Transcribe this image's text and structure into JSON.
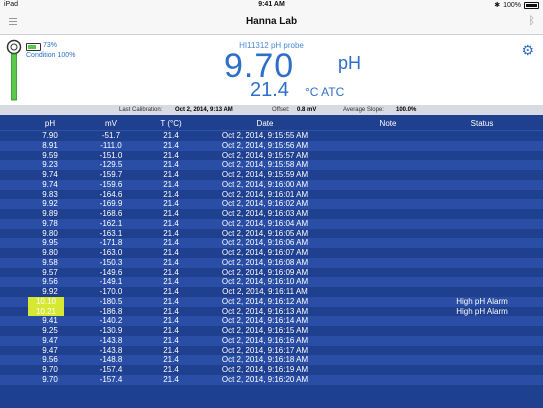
{
  "statusbar": {
    "device": "iPad",
    "time": "9:41 AM",
    "battery": "100%"
  },
  "navbar": {
    "title": "Hanna Lab"
  },
  "probe": {
    "battery_pct": "73%",
    "condition": "Condition 100%",
    "name": "HI11312 pH probe",
    "ph_value": "9.70",
    "ph_unit": "pH",
    "temp_value": "21.4",
    "temp_unit": "°C ATC"
  },
  "calibration": {
    "last_label": "Last Calibration:",
    "last_value": "Oct 2, 2014, 9:13 AM",
    "offset_label": "Offset:",
    "offset_value": "0.8 mV",
    "slope_label": "Average Slope:",
    "slope_value": "100.0%"
  },
  "table": {
    "headers": {
      "ph": "pH",
      "mv": "mV",
      "t": "T (°C)",
      "date": "Date",
      "note": "Note",
      "status": "Status"
    },
    "rows": [
      {
        "ph": "7.90",
        "mv": "-51.7",
        "t": "21.4",
        "date": "Oct 2, 2014, 9:15:55 AM",
        "note": "",
        "status": "",
        "highlight": false
      },
      {
        "ph": "8.91",
        "mv": "-111.0",
        "t": "21.4",
        "date": "Oct 2, 2014, 9:15:56 AM",
        "note": "",
        "status": "",
        "highlight": false
      },
      {
        "ph": "9.59",
        "mv": "-151.0",
        "t": "21.4",
        "date": "Oct 2, 2014, 9:15:57 AM",
        "note": "",
        "status": "",
        "highlight": false
      },
      {
        "ph": "9.23",
        "mv": "-129.5",
        "t": "21.4",
        "date": "Oct 2, 2014, 9:15:58 AM",
        "note": "",
        "status": "",
        "highlight": false
      },
      {
        "ph": "9.74",
        "mv": "-159.7",
        "t": "21.4",
        "date": "Oct 2, 2014, 9:15:59 AM",
        "note": "",
        "status": "",
        "highlight": false
      },
      {
        "ph": "9.74",
        "mv": "-159.6",
        "t": "21.4",
        "date": "Oct 2, 2014, 9:16:00 AM",
        "note": "",
        "status": "",
        "highlight": false
      },
      {
        "ph": "9.83",
        "mv": "-164.6",
        "t": "21.4",
        "date": "Oct 2, 2014, 9:16:01 AM",
        "note": "",
        "status": "",
        "highlight": false
      },
      {
        "ph": "9.92",
        "mv": "-169.9",
        "t": "21.4",
        "date": "Oct 2, 2014, 9:16:02 AM",
        "note": "",
        "status": "",
        "highlight": false
      },
      {
        "ph": "9.89",
        "mv": "-168.6",
        "t": "21.4",
        "date": "Oct 2, 2014, 9:16:03 AM",
        "note": "",
        "status": "",
        "highlight": false
      },
      {
        "ph": "9.78",
        "mv": "-162.1",
        "t": "21.4",
        "date": "Oct 2, 2014, 9:16:04 AM",
        "note": "",
        "status": "",
        "highlight": false
      },
      {
        "ph": "9.80",
        "mv": "-163.1",
        "t": "21.4",
        "date": "Oct 2, 2014, 9:16:05 AM",
        "note": "",
        "status": "",
        "highlight": false
      },
      {
        "ph": "9.95",
        "mv": "-171.8",
        "t": "21.4",
        "date": "Oct 2, 2014, 9:16:06 AM",
        "note": "",
        "status": "",
        "highlight": false
      },
      {
        "ph": "9.80",
        "mv": "-163.0",
        "t": "21.4",
        "date": "Oct 2, 2014, 9:16:07 AM",
        "note": "",
        "status": "",
        "highlight": false
      },
      {
        "ph": "9.58",
        "mv": "-150.3",
        "t": "21.4",
        "date": "Oct 2, 2014, 9:16:08 AM",
        "note": "",
        "status": "",
        "highlight": false
      },
      {
        "ph": "9.57",
        "mv": "-149.6",
        "t": "21.4",
        "date": "Oct 2, 2014, 9:16:09 AM",
        "note": "",
        "status": "",
        "highlight": false
      },
      {
        "ph": "9.56",
        "mv": "-149.1",
        "t": "21.4",
        "date": "Oct 2, 2014, 9:16:10 AM",
        "note": "",
        "status": "",
        "highlight": false
      },
      {
        "ph": "9.92",
        "mv": "-170.0",
        "t": "21.4",
        "date": "Oct 2, 2014, 9:16:11 AM",
        "note": "",
        "status": "",
        "highlight": false
      },
      {
        "ph": "10.10",
        "mv": "-180.5",
        "t": "21.4",
        "date": "Oct 2, 2014, 9:16:12 AM",
        "note": "",
        "status": "High pH Alarm",
        "highlight": true
      },
      {
        "ph": "10.21",
        "mv": "-186.8",
        "t": "21.4",
        "date": "Oct 2, 2014, 9:16:13 AM",
        "note": "",
        "status": "High pH Alarm",
        "highlight": true
      },
      {
        "ph": "9.41",
        "mv": "-140.2",
        "t": "21.4",
        "date": "Oct 2, 2014, 9:16:14 AM",
        "note": "",
        "status": "",
        "highlight": false
      },
      {
        "ph": "9.25",
        "mv": "-130.9",
        "t": "21.4",
        "date": "Oct 2, 2014, 9:16:15 AM",
        "note": "",
        "status": "",
        "highlight": false
      },
      {
        "ph": "9.47",
        "mv": "-143.8",
        "t": "21.4",
        "date": "Oct 2, 2014, 9:16:16 AM",
        "note": "",
        "status": "",
        "highlight": false
      },
      {
        "ph": "9.47",
        "mv": "-143.8",
        "t": "21.4",
        "date": "Oct 2, 2014, 9:16:17 AM",
        "note": "",
        "status": "",
        "highlight": false
      },
      {
        "ph": "9.56",
        "mv": "-148.8",
        "t": "21.4",
        "date": "Oct 2, 2014, 9:16:18 AM",
        "note": "",
        "status": "",
        "highlight": false
      },
      {
        "ph": "9.70",
        "mv": "-157.4",
        "t": "21.4",
        "date": "Oct 2, 2014, 9:16:19 AM",
        "note": "",
        "status": "",
        "highlight": false
      },
      {
        "ph": "9.70",
        "mv": "-157.4",
        "t": "21.4",
        "date": "Oct 2, 2014, 9:16:20 AM",
        "note": "",
        "status": "",
        "highlight": false
      }
    ]
  },
  "colors": {
    "accent": "#2d6fc8",
    "table_bg": "#1f3f8f",
    "table_alt": "#2a4ea6",
    "alarm_highlight": "#d6e832",
    "probe_green": "#5ac84a"
  }
}
